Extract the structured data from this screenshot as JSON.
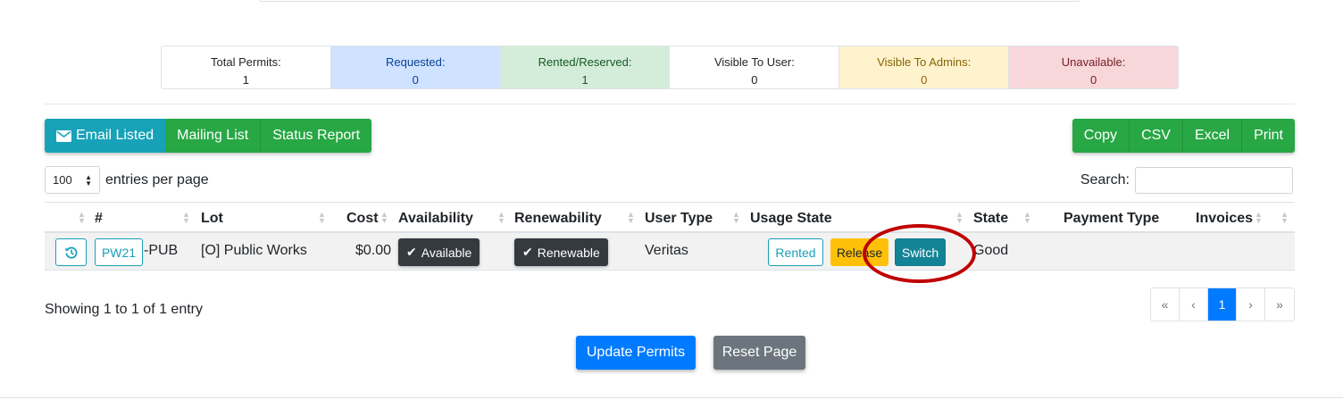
{
  "stats": [
    {
      "label": "Total Permits:",
      "value": "1",
      "bg": "#ffffff",
      "color": "#212529"
    },
    {
      "label": "Requested:",
      "value": "0",
      "bg": "#cfe2ff",
      "color": "#084298"
    },
    {
      "label": "Rented/Reserved:",
      "value": "1",
      "bg": "#d4edda",
      "color": "#155724"
    },
    {
      "label": "Visible To User:",
      "value": "0",
      "bg": "#ffffff",
      "color": "#212529"
    },
    {
      "label": "Visible To Admins:",
      "value": "0",
      "bg": "#fff3cd",
      "color": "#856404"
    },
    {
      "label": "Unavailable:",
      "value": "0",
      "bg": "#f8d7da",
      "color": "#721c24"
    }
  ],
  "toolbar_left": {
    "email_listed": "Email Listed",
    "mailing_list": "Mailing List",
    "status_report": "Status Report"
  },
  "toolbar_right": {
    "copy": "Copy",
    "csv": "CSV",
    "excel": "Excel",
    "print": "Print"
  },
  "length": {
    "value": "100",
    "label": "entries per page"
  },
  "search": {
    "label": "Search:",
    "value": ""
  },
  "columns": {
    "number": "#",
    "lot": "Lot",
    "cost": "Cost",
    "availability": "Availability",
    "renewability": "Renewability",
    "user_type": "User Type",
    "usage_state": "Usage State",
    "state": "State",
    "payment_type": "Payment Type",
    "invoices": "Invoices"
  },
  "row": {
    "permit_code": "PW21",
    "permit_suffix": "-PUB",
    "lot": "[O] Public Works",
    "cost": "$0.00",
    "availability": "Available",
    "renewability": "Renewable",
    "user_type": "Veritas",
    "usage_rented": "Rented",
    "usage_release": "Release",
    "usage_switch": "Switch",
    "state": "Good",
    "payment_type": "",
    "invoices": ""
  },
  "info": "Showing 1 to 1 of 1 entry",
  "pager": {
    "first": "«",
    "prev": "‹",
    "current": "1",
    "next": "›",
    "last": "»"
  },
  "actions": {
    "update": "Update Permits",
    "reset": "Reset Page"
  }
}
